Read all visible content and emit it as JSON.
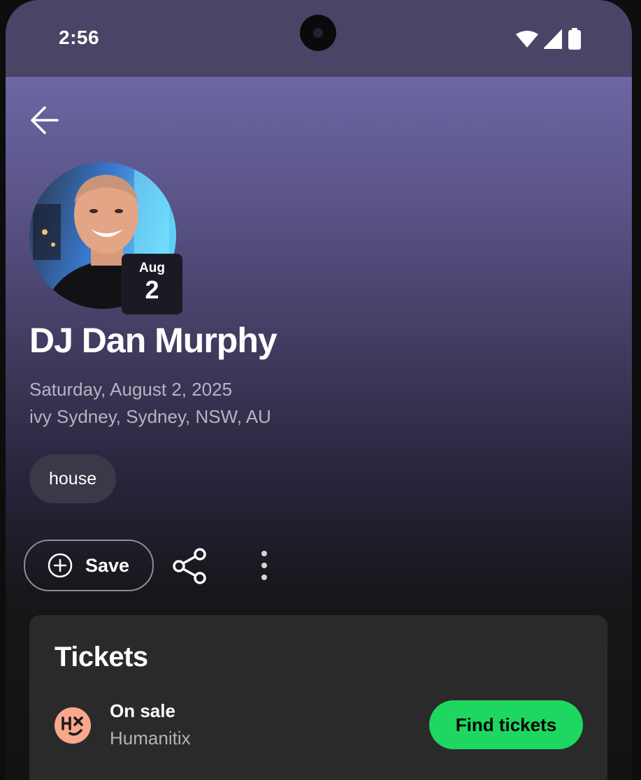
{
  "status_bar": {
    "time": "2:56",
    "icons": [
      "wifi-icon",
      "cellular-signal-icon",
      "battery-icon"
    ]
  },
  "header": {
    "back_icon": "arrow-left-icon"
  },
  "event": {
    "badge_month": "Aug",
    "badge_day": "2",
    "title": "DJ Dan Murphy",
    "date_line": "Saturday, August 2, 2025",
    "venue_line": "ivy Sydney, Sydney, NSW, AU",
    "genre": "house"
  },
  "actions": {
    "save_label": "Save",
    "save_icon": "plus-circle-icon",
    "share_icon": "share-icon",
    "more_icon": "more-vertical-icon"
  },
  "tickets": {
    "heading": "Tickets",
    "status": "On sale",
    "provider": "Humanitix",
    "provider_logo_color": "#f7a88a",
    "button_label": "Find tickets",
    "button_color": "#1ed760"
  },
  "colors": {
    "header_gradient_top": "#6c66a4",
    "background": "#121212",
    "card": "#2a2a2a",
    "accent": "#1ed760"
  }
}
